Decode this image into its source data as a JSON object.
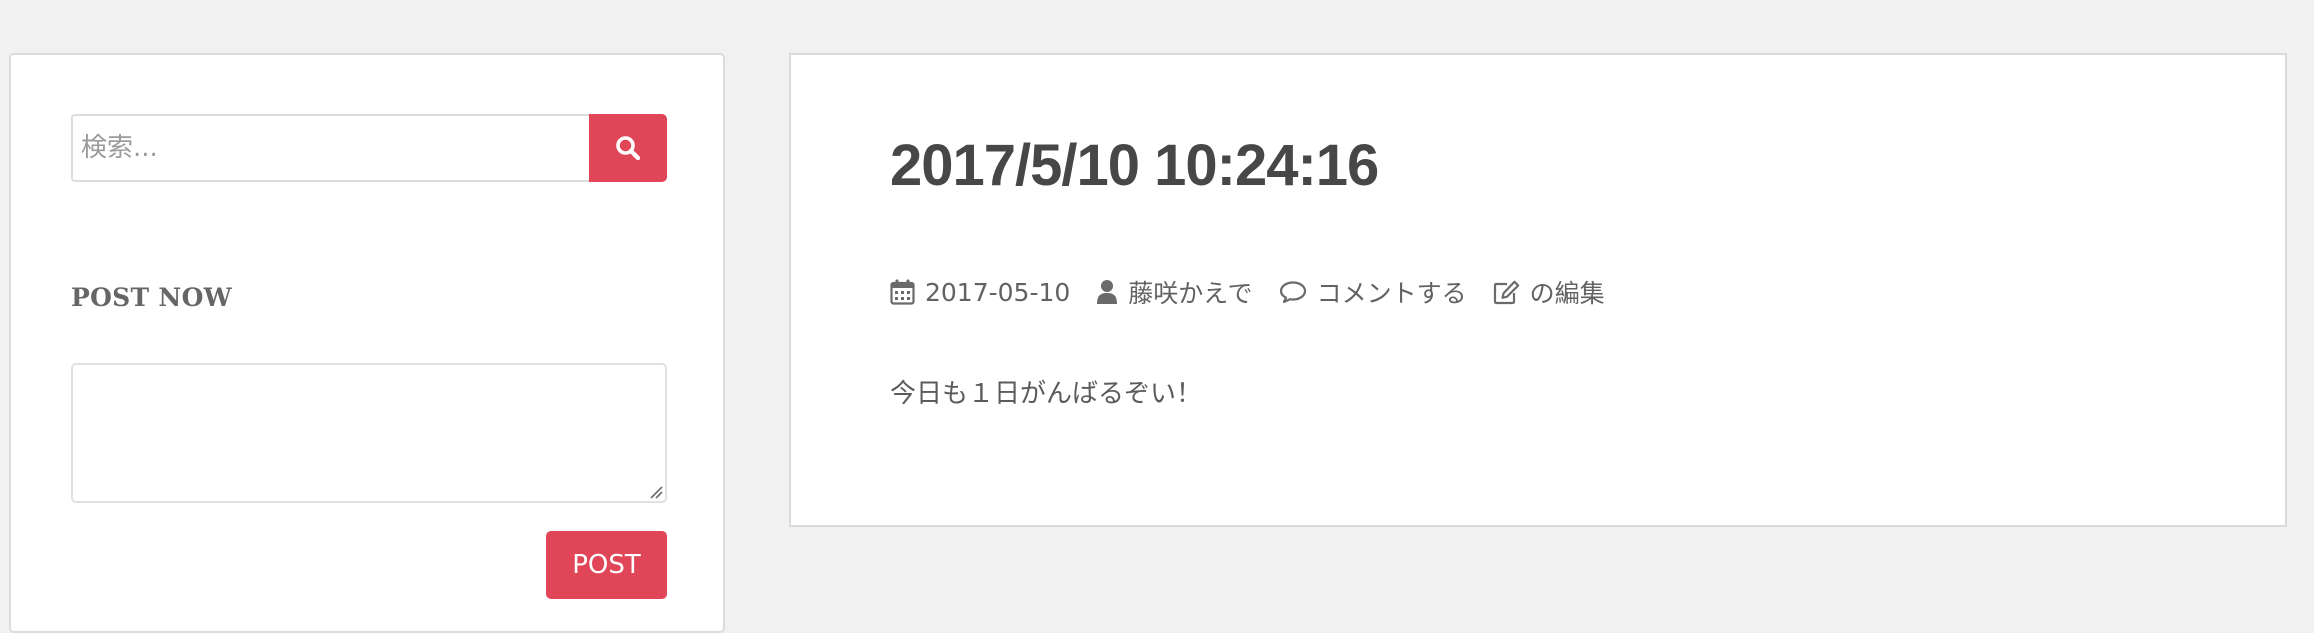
{
  "sidebar": {
    "search": {
      "placeholder": "検索...",
      "icon": "search-icon"
    },
    "post_widget": {
      "title": "POST NOW",
      "textarea_value": "",
      "button_label": "POST"
    }
  },
  "article": {
    "title": "2017/5/10 10:24:16",
    "meta": {
      "date": "2017-05-10",
      "date_icon": "calendar-icon",
      "author": "藤咲かえで",
      "author_icon": "user-icon",
      "comment_label": "コメントする",
      "comment_icon": "comment-icon",
      "edit_label": "の編集",
      "edit_icon": "edit-icon"
    },
    "content": "今日も１日がんばるぞい！"
  },
  "colors": {
    "accent": "#e04558",
    "background": "#f1f1f1",
    "panel": "#ffffff",
    "title_text": "#474747",
    "body_text": "#5b5b5b"
  }
}
